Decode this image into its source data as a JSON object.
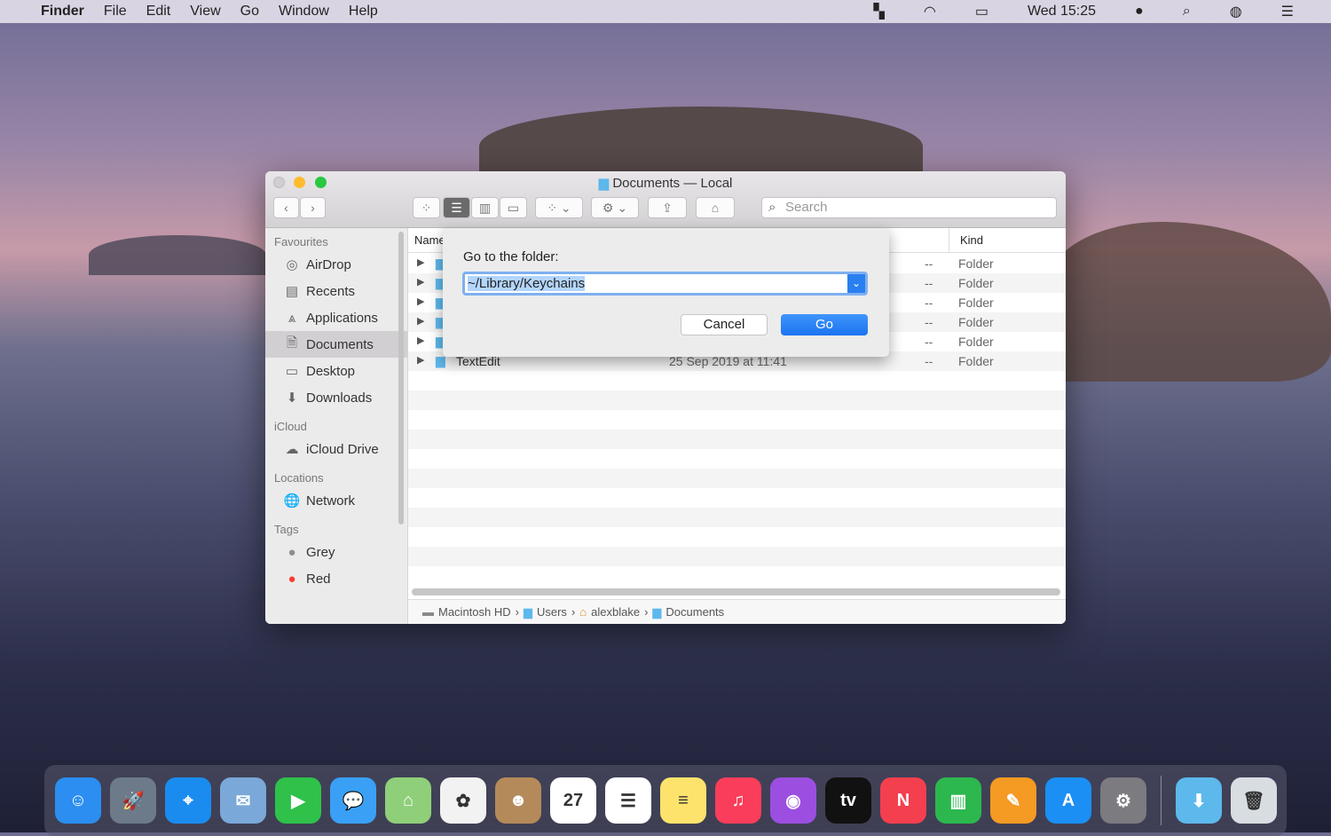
{
  "menubar": {
    "app": "Finder",
    "items": [
      "File",
      "Edit",
      "View",
      "Go",
      "Window",
      "Help"
    ],
    "clock": "Wed 15:25"
  },
  "window": {
    "title": "Documents — Local",
    "search_placeholder": "Search"
  },
  "sidebar": {
    "favourites": "Favourites",
    "fav_items": [
      {
        "label": "AirDrop",
        "icon": "◎"
      },
      {
        "label": "Recents",
        "icon": "▤"
      },
      {
        "label": "Applications",
        "icon": "⩓"
      },
      {
        "label": "Documents",
        "icon": "🗎"
      },
      {
        "label": "Desktop",
        "icon": "▭"
      },
      {
        "label": "Downloads",
        "icon": "⬇"
      }
    ],
    "icloud": "iCloud",
    "icloud_items": [
      {
        "label": "iCloud Drive",
        "icon": "☁"
      }
    ],
    "locations": "Locations",
    "location_items": [
      {
        "label": "Network",
        "icon": "🌐"
      }
    ],
    "tags": "Tags",
    "tag_items": [
      {
        "label": "Grey",
        "color": "#8e8e93"
      },
      {
        "label": "Red",
        "color": "#ff3b30"
      }
    ]
  },
  "list": {
    "col_name": "Name",
    "col_kind": "Kind",
    "rows": [
      {
        "name": "",
        "date": "",
        "size": "--",
        "kind": "Folder"
      },
      {
        "name": "",
        "date": "",
        "size": "--",
        "kind": "Folder"
      },
      {
        "name": "",
        "date": "",
        "size": "--",
        "kind": "Folder"
      },
      {
        "name": "",
        "date": "",
        "size": "--",
        "kind": "Folder"
      },
      {
        "name": "",
        "date": "",
        "size": "--",
        "kind": "Folder"
      },
      {
        "name": "TextEdit",
        "date": "25 Sep 2019 at 11:41",
        "size": "--",
        "kind": "Folder"
      }
    ]
  },
  "dialog": {
    "label": "Go to the folder:",
    "value": "~/Library/Keychains",
    "cancel": "Cancel",
    "go": "Go"
  },
  "pathbar": [
    "Macintosh HD",
    "Users",
    "alexblake",
    "Documents"
  ],
  "dock": [
    {
      "name": "finder",
      "color": "#2b8ef0",
      "glyph": "☺"
    },
    {
      "name": "launchpad",
      "color": "#6c7a8a",
      "glyph": "🚀"
    },
    {
      "name": "safari",
      "color": "#1a8cf0",
      "glyph": "⌖"
    },
    {
      "name": "mail",
      "color": "#7aa8d8",
      "glyph": "✉"
    },
    {
      "name": "facetime",
      "color": "#2fc14a",
      "glyph": "▶"
    },
    {
      "name": "messages",
      "color": "#3aa0f5",
      "glyph": "💬"
    },
    {
      "name": "maps",
      "color": "#8fcf7a",
      "glyph": "⌂"
    },
    {
      "name": "photos",
      "color": "#f2f2f2",
      "glyph": "✿"
    },
    {
      "name": "contacts",
      "color": "#b48a5a",
      "glyph": "☻"
    },
    {
      "name": "calendar",
      "color": "#ffffff",
      "glyph": "27"
    },
    {
      "name": "reminders",
      "color": "#ffffff",
      "glyph": "☰"
    },
    {
      "name": "notes",
      "color": "#fde36b",
      "glyph": "≡"
    },
    {
      "name": "music",
      "color": "#fa3d5a",
      "glyph": "♫"
    },
    {
      "name": "podcasts",
      "color": "#9b4ee0",
      "glyph": "◉"
    },
    {
      "name": "tv",
      "color": "#111111",
      "glyph": "tv"
    },
    {
      "name": "news",
      "color": "#f43f4f",
      "glyph": "N"
    },
    {
      "name": "numbers",
      "color": "#2cb84e",
      "glyph": "▥"
    },
    {
      "name": "pages",
      "color": "#f59a23",
      "glyph": "✎"
    },
    {
      "name": "app-store",
      "color": "#1b8ff3",
      "glyph": "A"
    },
    {
      "name": "system-preferences",
      "color": "#7b7b80",
      "glyph": "⚙"
    },
    {
      "name": "downloads-folder",
      "color": "#5db8ec",
      "glyph": "⬇"
    },
    {
      "name": "trash",
      "color": "#d8dde2",
      "glyph": "🗑"
    }
  ]
}
